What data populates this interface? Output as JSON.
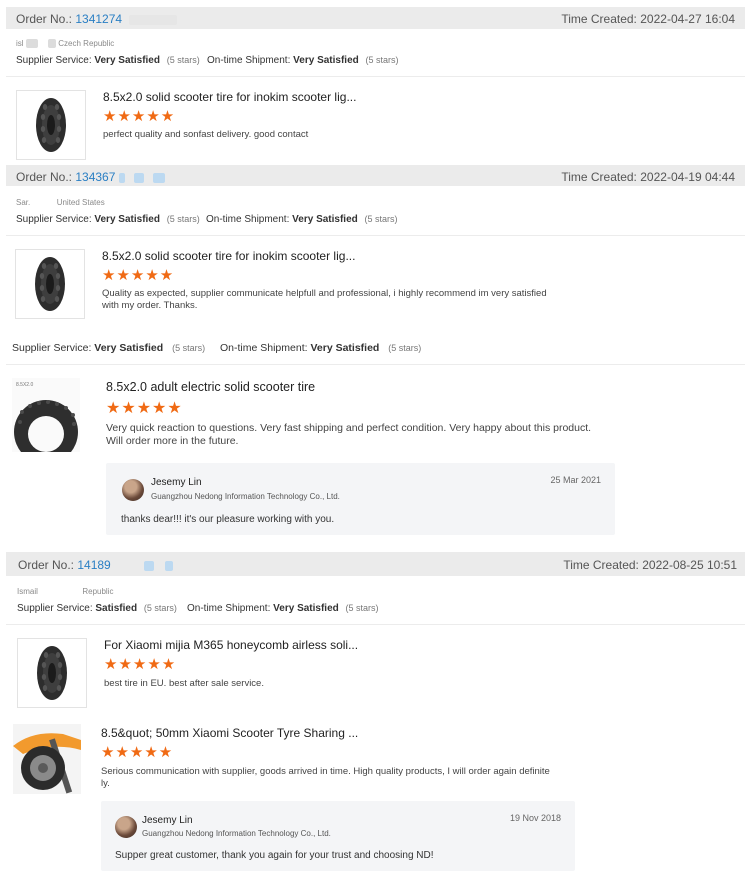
{
  "orders": [
    {
      "order_label": "Order No.:",
      "order_no": "1341274",
      "time_label": "Time Created:",
      "time": "2022-04-27 16:04",
      "buyer_name": "isl",
      "buyer_country": "Czech Republic",
      "supplier_service_label": "Supplier Service:",
      "supplier_service_value": "Very Satisfied",
      "supplier_service_stars": "(5 stars)",
      "shipment_label": "On-time Shipment:",
      "shipment_value": "Very Satisfied",
      "shipment_stars": "(5 stars)",
      "reviews": [
        {
          "title": "8.5x2.0 solid scooter tire for inokim scooter lig...",
          "stars": "★★★★★",
          "text": "perfect quality and sonfast delivery. good contact",
          "image_icon": "honeycomb-tire-icon"
        }
      ]
    },
    {
      "order_label": "Order No.:",
      "order_no": "134367",
      "time_label": "Time Created:",
      "time": "2022-04-19 04:44",
      "buyer_name": "Sar.",
      "buyer_country": "United States",
      "supplier_service_label": "Supplier Service:",
      "supplier_service_value": "Very Satisfied",
      "supplier_service_stars": "(5 stars)",
      "shipment_label": "On-time Shipment:",
      "shipment_value": "Very Satisfied",
      "shipment_stars": "(5 stars)",
      "reviews": [
        {
          "title": "8.5x2.0 solid scooter tire for inokim scooter lig...",
          "stars": "★★★★★",
          "text_line1": "Quality as expected, supplier communicate helpfull and professional, i highly recommend im very satisfied",
          "text_line2": "with my order. Thanks.",
          "image_icon": "honeycomb-tire-icon"
        }
      ]
    },
    {
      "supplier_service_label": "Supplier Service:",
      "supplier_service_value": "Very Satisfied",
      "supplier_service_stars": "(5 stars)",
      "shipment_label": "On-time Shipment:",
      "shipment_value": "Very Satisfied",
      "shipment_stars": "(5 stars)",
      "reviews": [
        {
          "title": "8.5x2.0 adult electric solid scooter tire",
          "stars": "★★★★★",
          "text_line1": "Very quick reaction to questions. Very fast shipping and perfect condition. Very happy about this product.",
          "text_line2": "Will order more in the future.",
          "image_icon": "tire-closeup-icon",
          "image_caption": "8.5X2.0",
          "reply": {
            "name": "Jesemy Lin",
            "company": "Guangzhou Nedong Information Technology Co., Ltd.",
            "date": "25 Mar 2021",
            "message": "thanks dear!!!   it's our pleasure working with you."
          }
        }
      ]
    },
    {
      "order_label": "Order No.:",
      "order_no": "14189",
      "time_label": "Time Created:",
      "time": "2022-08-25 10:51",
      "buyer_name": "Ismail",
      "buyer_country": "Republic",
      "supplier_service_label": "Supplier Service:",
      "supplier_service_value": "Satisfied",
      "supplier_service_stars": "(5 stars)",
      "shipment_label": "On-time Shipment:",
      "shipment_value": "Very Satisfied",
      "shipment_stars": "(5 stars)",
      "reviews": [
        {
          "title": "For Xiaomi mijia M365 honeycomb airless soli...",
          "stars": "★★★★★",
          "text": "best tire in EU. best after sale service.",
          "image_icon": "honeycomb-tire-icon"
        },
        {
          "title": "8.5&quot; 50mm Xiaomi Scooter Tyre Sharing ...",
          "stars": "★★★★★",
          "text_line1": "Serious communication with supplier, goods arrived in time. High quality products, I will order again definite",
          "text_line2": "ly.",
          "image_icon": "scooter-wheel-icon",
          "reply": {
            "name": "Jesemy Lin",
            "company": "Guangzhou Nedong Information Technology Co., Ltd.",
            "date": "19 Nov 2018",
            "message": "Supper great customer, thank you again for your trust and choosing ND!"
          }
        }
      ]
    }
  ]
}
